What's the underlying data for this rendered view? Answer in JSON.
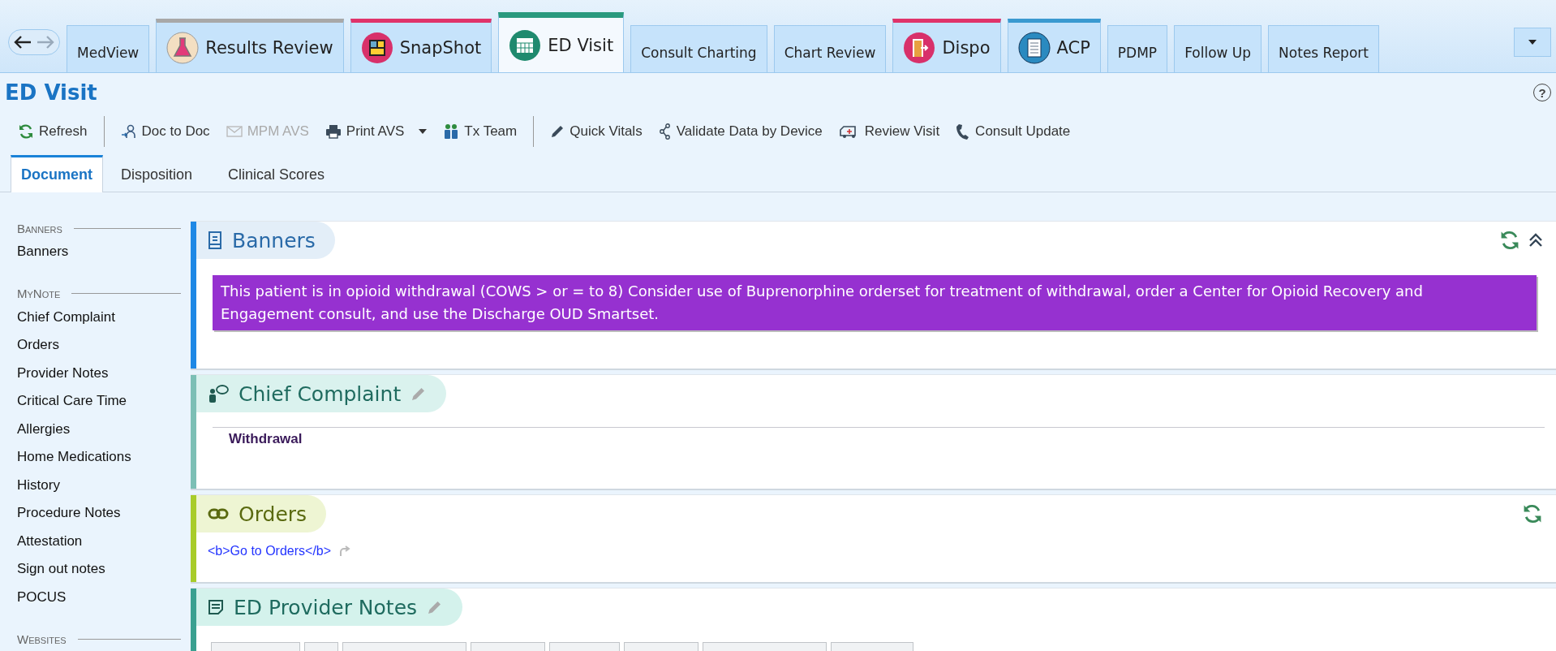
{
  "tabs": [
    {
      "label": "MedView",
      "kind": "plain",
      "selected": false
    },
    {
      "label": "Results Review",
      "kind": "flask",
      "color": "#a8a8a8",
      "selected": false
    },
    {
      "label": "SnapShot",
      "kind": "gallery",
      "color": "#e0336a",
      "selected": false
    },
    {
      "label": "ED Visit",
      "kind": "calendar",
      "color": "#2a9a7e",
      "selected": true
    },
    {
      "label": "Consult Charting",
      "kind": "plain",
      "selected": false
    },
    {
      "label": "Chart Review",
      "kind": "plain",
      "selected": false
    },
    {
      "label": "Dispo",
      "kind": "door",
      "color": "#e0336a",
      "selected": false
    },
    {
      "label": "ACP",
      "kind": "notebook",
      "color": "#3a9ad0",
      "selected": false
    },
    {
      "label": "PDMP",
      "kind": "plain",
      "selected": false
    },
    {
      "label": "Follow Up",
      "kind": "plain",
      "selected": false
    },
    {
      "label": "Notes Report",
      "kind": "plain",
      "selected": false
    }
  ],
  "page_title": "ED Visit",
  "help": "?",
  "toolbar": [
    [
      {
        "label": "Refresh",
        "disabled": false,
        "menu": false
      }
    ],
    [
      {
        "label": "Doc to Doc",
        "disabled": false,
        "menu": false
      },
      {
        "label": "MPM AVS",
        "disabled": true,
        "menu": false
      },
      {
        "label": "Print AVS",
        "disabled": false,
        "menu": true
      },
      {
        "label": "Tx Team",
        "disabled": false,
        "menu": false
      }
    ],
    [
      {
        "label": "Quick Vitals",
        "disabled": false,
        "menu": false
      },
      {
        "label": "Validate Data by Device",
        "disabled": false,
        "menu": false
      },
      {
        "label": "Review Visit",
        "disabled": false,
        "menu": false
      },
      {
        "label": "Consult Update",
        "disabled": false,
        "menu": false
      }
    ]
  ],
  "subtabs": [
    {
      "label": "Document",
      "selected": true
    },
    {
      "label": "Disposition",
      "selected": false
    },
    {
      "label": "Clinical Scores",
      "selected": false
    }
  ],
  "sidebar": [
    {
      "heading": "Banners",
      "items": [
        "Banners"
      ]
    },
    {
      "heading": "MyNote",
      "items": [
        "Chief Complaint",
        "Orders",
        "Provider Notes",
        "Critical Care Time",
        "Allergies",
        "Home Medications",
        "History",
        "Procedure Notes",
        "Attestation",
        "Sign out notes",
        "POCUS"
      ]
    },
    {
      "heading": "Websites"
    }
  ],
  "sections": [
    {
      "title": "Banners",
      "kind": "banner",
      "color": "#1e88e5",
      "editable": false,
      "refreshable": true,
      "collapsible": true,
      "text": "This patient is in opioid withdrawal (COWS > or = to 8) Consider use of Buprenorphine orderset for treatment of withdrawal, order a Center for Opioid Recovery and Engagement consult, and use the Discharge OUD Smartset."
    },
    {
      "title": "Chief Complaint",
      "kind": "complaint",
      "color": "#7cbfb5",
      "editable": true,
      "refreshable": false,
      "collapsible": false,
      "text": "Withdrawal"
    },
    {
      "title": "Orders",
      "kind": "link",
      "color": "#a8cc2a",
      "editable": false,
      "refreshable": true,
      "collapsible": false,
      "text": "<b>Go to Orders</b>"
    },
    {
      "title": "ED Provider Notes",
      "kind": "notes",
      "color": "#3aa090",
      "editable": true,
      "refreshable": false,
      "collapsible": false
    }
  ]
}
